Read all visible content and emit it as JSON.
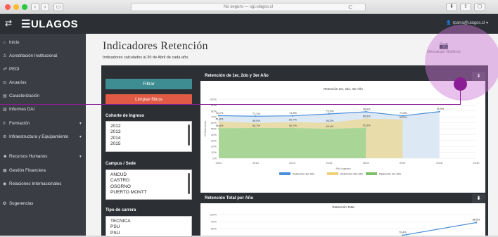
{
  "browser": {
    "url": "No seguro — sgi.ulagos.cl",
    "back": "‹",
    "forward": "›",
    "sidebar_toggle": "▭",
    "reload": "C",
    "download_icon": "⬇",
    "share_icon": "⇪",
    "tabs_icon": "▢"
  },
  "header": {
    "menu_icon": "⇄",
    "logo": "☰ULAGOS",
    "user": "👤 rparra@ulagos.cl ▾"
  },
  "sidebar": {
    "items": [
      {
        "icon": "⌂",
        "label": "Inicio",
        "caret": ""
      },
      {
        "icon": "♙",
        "label": "Acreditación Institucional",
        "caret": ""
      },
      {
        "icon": "☍",
        "label": "PEDI",
        "caret": ""
      },
      {
        "icon": "⊡",
        "label": "Anuarios",
        "caret": ""
      },
      {
        "icon": "▤",
        "label": "Caracterización",
        "caret": ""
      },
      {
        "icon": "▥",
        "label": "Informes DAI",
        "caret": ""
      },
      {
        "icon": "≡",
        "label": "Formación",
        "caret": "▾"
      },
      {
        "icon": "⚙",
        "label": "Infraestructura y Equipamiento",
        "caret": "▾"
      },
      {
        "icon": "☻",
        "label": "Recursos Humanos",
        "caret": "▾"
      },
      {
        "icon": "▦",
        "label": "Gestión Financiera",
        "caret": ""
      },
      {
        "icon": "◉",
        "label": "Relaciones Internacionales",
        "caret": ""
      },
      {
        "icon": "✪",
        "label": "Sugerencias",
        "caret": ""
      }
    ]
  },
  "page": {
    "title": "Indicadores Retención",
    "subtitle": "Indicadores calculados al 30 de Abril de cada año.",
    "download_label": "Descargar Gráficos",
    "camera_icon": "📷"
  },
  "filters": {
    "filtrar": "Filtrar",
    "limpiar": "Limpiar filtros",
    "cohorte_label": "Cohorte de Ingreso",
    "cohorte_options": [
      "2012",
      "2013",
      "2014",
      "2015"
    ],
    "campus_label": "Campus / Sede",
    "campus_options": [
      "ANCUD",
      "CASTRO",
      "OSORNO",
      "PUERTO MONTT"
    ],
    "carrera_label": "Tipo de carrera",
    "carrera_options": [
      "TECNICA",
      "PSU",
      "PSU"
    ]
  },
  "chart1_card": {
    "header": "Retención de 1er, 2do y 3er Año",
    "download_icon": "⬇"
  },
  "chart2_card": {
    "header": "Retención Total por Año",
    "download_icon": "⬇"
  },
  "chart_data": [
    {
      "type": "area",
      "title": "Retención 1er, 2do, 3er Año",
      "xlabel": "Año Ingreso",
      "ylabel": "% Retención",
      "categories": [
        "2012",
        "2013",
        "2014",
        "2015",
        "2016",
        "2017",
        "2018",
        "2019"
      ],
      "ylim": [
        0,
        100
      ],
      "yticks": [
        "100%",
        "90%",
        "80%",
        "70%",
        "60%",
        "50%",
        "40%",
        "30%",
        "20%",
        "10%",
        "0%"
      ],
      "series": [
        {
          "name": "Retención 1er Año",
          "color": "#4a90d9",
          "values": [
            72.1,
            71.1,
            71.8,
            75.0,
            78.6,
            71.8,
            78.9,
            null
          ],
          "labels": [
            "72.1%",
            "71.1%",
            "71.8%",
            "75.0%",
            "78.6%",
            "71.8%",
            "78.9%",
            ""
          ]
        },
        {
          "name": "Retención 2do Año",
          "color": "#e8d9a0",
          "values": [
            61.8,
            59.0,
            60.7,
            59.2,
            66.5,
            64.9,
            null,
            null
          ],
          "labels": [
            "61.8%",
            "59.0%",
            "60.7%",
            "59.2%",
            "66.5%",
            "64.9%",
            "",
            ""
          ]
        },
        {
          "name": "Retención 3er Año",
          "color": "#a8d99a",
          "values": [
            50.4,
            50.7,
            50.7,
            49.4,
            51.0,
            null,
            null,
            null
          ],
          "labels": [
            "50.4%",
            "50.7%",
            "50.7%",
            "49.4%",
            "51.0%",
            "",
            "",
            ""
          ]
        }
      ],
      "legend": "bottom",
      "grid": true
    },
    {
      "type": "line",
      "title": "Retención Total",
      "categories": [
        "2012",
        "2013",
        "2014",
        "2015",
        "2016",
        "2017",
        "2018",
        "2019"
      ],
      "ylim": [
        0,
        100
      ],
      "yticks": [
        "100%",
        "90%",
        "80%"
      ],
      "series": [
        {
          "name": "",
          "color": "#4a90d9",
          "values": [
            null,
            null,
            null,
            null,
            null,
            70.4,
            null,
            88.5
          ],
          "labels": [
            "",
            "",
            "",
            "",
            "",
            "70.4%",
            "",
            "88.5%"
          ]
        }
      ]
    }
  ]
}
